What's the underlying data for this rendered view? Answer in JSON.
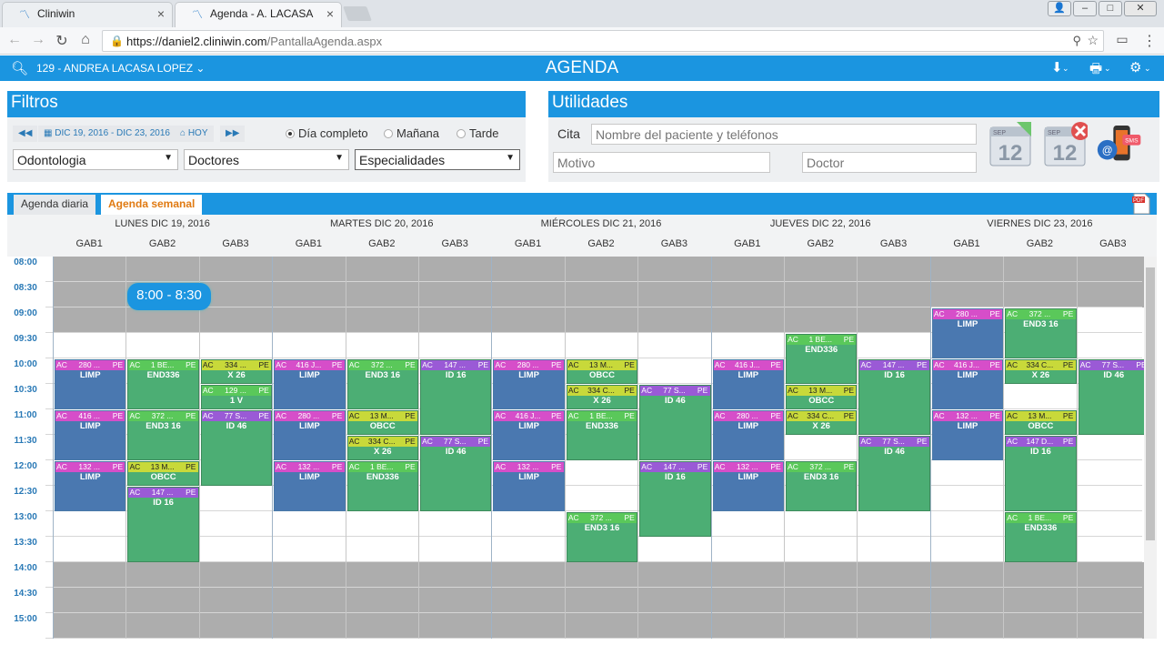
{
  "browser": {
    "tabs": [
      {
        "label": "Cliniwin"
      },
      {
        "label": "Agenda - A. LACASA"
      }
    ],
    "url_host": "https://daniel2.cliniwin.com",
    "url_path": "/PantallaAgenda.aspx"
  },
  "header": {
    "user": "129 - ANDREA LACASA LOPEZ ⌄",
    "title": "AGENDA"
  },
  "filtros": {
    "title": "Filtros",
    "prev": "◀◀",
    "range": "DIC 19, 2016 - DIC 23, 2016",
    "hoy": "HOY",
    "next": "▶▶",
    "radios": [
      {
        "label": "Día completo",
        "checked": true
      },
      {
        "label": "Mañana",
        "checked": false
      },
      {
        "label": "Tarde",
        "checked": false
      }
    ],
    "selects": [
      "Odontologia",
      "Doctores",
      "Especialidades"
    ]
  },
  "utilidades": {
    "title": "Utilidades",
    "cita_label": "Cita",
    "cita_placeholder": "Nombre del paciente y teléfonos",
    "motivo_placeholder": "Motivo",
    "doctor_placeholder": "Doctor",
    "cal_month": "SEP",
    "cal_day": "12",
    "sms_label": "SMS"
  },
  "agenda_tabs": [
    "Agenda diaria",
    "Agenda semanal"
  ],
  "days": [
    "LUNES DIC 19, 2016",
    "MARTES DIC 20, 2016",
    "MIÉRCOLES DIC 21, 2016",
    "JUEVES DIC 22, 2016",
    "VIERNES DIC 23, 2016"
  ],
  "gabs": [
    "GAB1",
    "GAB2",
    "GAB3"
  ],
  "times": [
    "08:00",
    "08:30",
    "09:00",
    "09:30",
    "10:00",
    "10:30",
    "11:00",
    "11:30",
    "12:00",
    "12:30",
    "13:00",
    "13:30",
    "14:00",
    "14:30",
    "15:00",
    "15:30"
  ],
  "tooltip": "8:00 - 8:30",
  "appointments": [
    {
      "d": 0,
      "g": 0,
      "start": 10.0,
      "end": 11.0,
      "hdr": "pink",
      "label": "280 ...",
      "code": "LIMP",
      "color": "blue"
    },
    {
      "d": 0,
      "g": 0,
      "start": 11.0,
      "end": 12.0,
      "hdr": "pink",
      "label": "416 ...",
      "code": "LIMP",
      "color": "blue"
    },
    {
      "d": 0,
      "g": 0,
      "start": 12.0,
      "end": 13.0,
      "hdr": "pink",
      "label": "132 ...",
      "code": "LIMP",
      "color": "blue"
    },
    {
      "d": 0,
      "g": 1,
      "start": 10.0,
      "end": 11.0,
      "hdr": "green",
      "label": "1 BE...",
      "code": "END336",
      "color": "green"
    },
    {
      "d": 0,
      "g": 1,
      "start": 11.0,
      "end": 12.0,
      "hdr": "green",
      "label": "372 ...",
      "code": "END3 16",
      "color": "green"
    },
    {
      "d": 0,
      "g": 1,
      "start": 12.0,
      "end": 12.5,
      "hdr": "yellow",
      "label": "13 M...",
      "code": "OBCC",
      "color": "green"
    },
    {
      "d": 0,
      "g": 1,
      "start": 12.5,
      "end": 14.0,
      "hdr": "purple",
      "label": "147 ...",
      "code": "ID 16",
      "color": "green"
    },
    {
      "d": 0,
      "g": 2,
      "start": 10.0,
      "end": 10.5,
      "hdr": "yellow",
      "label": "334 ...",
      "code": "X 26",
      "color": "green"
    },
    {
      "d": 0,
      "g": 2,
      "start": 10.5,
      "end": 11.0,
      "hdr": "green",
      "label": "129 ...",
      "code": "1 V",
      "color": "green"
    },
    {
      "d": 0,
      "g": 2,
      "start": 11.0,
      "end": 12.5,
      "hdr": "purple",
      "label": "77 S...",
      "code": "ID 46",
      "color": "green"
    },
    {
      "d": 1,
      "g": 0,
      "start": 10.0,
      "end": 11.0,
      "hdr": "pink",
      "label": "416 J...",
      "code": "LIMP",
      "color": "blue"
    },
    {
      "d": 1,
      "g": 0,
      "start": 11.0,
      "end": 12.0,
      "hdr": "pink",
      "label": "280 ...",
      "code": "LIMP",
      "color": "blue"
    },
    {
      "d": 1,
      "g": 0,
      "start": 12.0,
      "end": 13.0,
      "hdr": "pink",
      "label": "132 ...",
      "code": "LIMP",
      "color": "blue"
    },
    {
      "d": 1,
      "g": 1,
      "start": 10.0,
      "end": 11.0,
      "hdr": "green",
      "label": "372 ...",
      "code": "END3 16",
      "color": "green"
    },
    {
      "d": 1,
      "g": 1,
      "start": 11.0,
      "end": 11.5,
      "hdr": "yellow",
      "label": "13 M...",
      "code": "OBCC",
      "color": "green"
    },
    {
      "d": 1,
      "g": 1,
      "start": 11.5,
      "end": 12.0,
      "hdr": "yellow",
      "label": "334 C...",
      "code": "X 26",
      "color": "green"
    },
    {
      "d": 1,
      "g": 1,
      "start": 12.0,
      "end": 13.0,
      "hdr": "green",
      "label": "1 BE...",
      "code": "END336",
      "color": "green"
    },
    {
      "d": 1,
      "g": 2,
      "start": 10.0,
      "end": 11.5,
      "hdr": "purple",
      "label": "147 ...",
      "code": "ID 16",
      "color": "green"
    },
    {
      "d": 1,
      "g": 2,
      "start": 11.5,
      "end": 13.0,
      "hdr": "purple",
      "label": "77 S...",
      "code": "ID 46",
      "color": "green"
    },
    {
      "d": 2,
      "g": 0,
      "start": 10.0,
      "end": 11.0,
      "hdr": "pink",
      "label": "280 ...",
      "code": "LIMP",
      "color": "blue"
    },
    {
      "d": 2,
      "g": 0,
      "start": 11.0,
      "end": 12.0,
      "hdr": "pink",
      "label": "416 J...",
      "code": "LIMP",
      "color": "blue"
    },
    {
      "d": 2,
      "g": 0,
      "start": 12.0,
      "end": 13.0,
      "hdr": "pink",
      "label": "132 ...",
      "code": "LIMP",
      "color": "blue"
    },
    {
      "d": 2,
      "g": 1,
      "start": 10.0,
      "end": 10.5,
      "hdr": "yellow",
      "label": "13 M...",
      "code": "OBCC",
      "color": "green"
    },
    {
      "d": 2,
      "g": 1,
      "start": 10.5,
      "end": 11.0,
      "hdr": "yellow",
      "label": "334 C...",
      "code": "X 26",
      "color": "green"
    },
    {
      "d": 2,
      "g": 1,
      "start": 11.0,
      "end": 12.0,
      "hdr": "green",
      "label": "1 BE...",
      "code": "END336",
      "color": "green"
    },
    {
      "d": 2,
      "g": 1,
      "start": 13.0,
      "end": 14.0,
      "hdr": "green",
      "label": "372 ...",
      "code": "END3 16",
      "color": "green"
    },
    {
      "d": 2,
      "g": 2,
      "start": 10.5,
      "end": 12.0,
      "hdr": "purple",
      "label": "77 S...",
      "code": "ID 46",
      "color": "green"
    },
    {
      "d": 2,
      "g": 2,
      "start": 12.0,
      "end": 13.5,
      "hdr": "purple",
      "label": "147 ...",
      "code": "ID 16",
      "color": "green"
    },
    {
      "d": 3,
      "g": 0,
      "start": 10.0,
      "end": 11.0,
      "hdr": "pink",
      "label": "416 J...",
      "code": "LIMP",
      "color": "blue"
    },
    {
      "d": 3,
      "g": 0,
      "start": 11.0,
      "end": 12.0,
      "hdr": "pink",
      "label": "280 ...",
      "code": "LIMP",
      "color": "blue"
    },
    {
      "d": 3,
      "g": 0,
      "start": 12.0,
      "end": 13.0,
      "hdr": "pink",
      "label": "132 ...",
      "code": "LIMP",
      "color": "blue"
    },
    {
      "d": 3,
      "g": 1,
      "start": 9.5,
      "end": 10.5,
      "hdr": "green",
      "label": "1 BE...",
      "code": "END336",
      "color": "green"
    },
    {
      "d": 3,
      "g": 1,
      "start": 10.5,
      "end": 11.0,
      "hdr": "yellow",
      "label": "13 M...",
      "code": "OBCC",
      "color": "green"
    },
    {
      "d": 3,
      "g": 1,
      "start": 11.0,
      "end": 11.5,
      "hdr": "yellow",
      "label": "334 C...",
      "code": "X 26",
      "color": "green"
    },
    {
      "d": 3,
      "g": 1,
      "start": 12.0,
      "end": 13.0,
      "hdr": "green",
      "label": "372 ...",
      "code": "END3 16",
      "color": "green"
    },
    {
      "d": 3,
      "g": 2,
      "start": 10.0,
      "end": 11.5,
      "hdr": "purple",
      "label": "147 ...",
      "code": "ID 16",
      "color": "green"
    },
    {
      "d": 3,
      "g": 2,
      "start": 11.5,
      "end": 13.0,
      "hdr": "purple",
      "label": "77 S...",
      "code": "ID 46",
      "color": "green"
    },
    {
      "d": 4,
      "g": 0,
      "start": 9.0,
      "end": 10.0,
      "hdr": "pink",
      "label": "280 ...",
      "code": "LIMP",
      "color": "blue"
    },
    {
      "d": 4,
      "g": 0,
      "start": 10.0,
      "end": 11.0,
      "hdr": "pink",
      "label": "416 J...",
      "code": "LIMP",
      "color": "blue"
    },
    {
      "d": 4,
      "g": 0,
      "start": 11.0,
      "end": 12.0,
      "hdr": "pink",
      "label": "132 ...",
      "code": "LIMP",
      "color": "blue"
    },
    {
      "d": 4,
      "g": 1,
      "start": 9.0,
      "end": 10.0,
      "hdr": "green",
      "label": "372 ...",
      "code": "END3 16",
      "color": "green"
    },
    {
      "d": 4,
      "g": 1,
      "start": 10.0,
      "end": 10.5,
      "hdr": "yellow",
      "label": "334 C...",
      "code": "X 26",
      "color": "green"
    },
    {
      "d": 4,
      "g": 1,
      "start": 11.0,
      "end": 11.5,
      "hdr": "yellow",
      "label": "13 M...",
      "code": "OBCC",
      "color": "green"
    },
    {
      "d": 4,
      "g": 1,
      "start": 11.5,
      "end": 13.0,
      "hdr": "purple",
      "label": "147 D...",
      "code": "ID 16",
      "color": "green"
    },
    {
      "d": 4,
      "g": 1,
      "start": 13.0,
      "end": 14.0,
      "hdr": "green",
      "label": "1 BE...",
      "code": "END336",
      "color": "green"
    },
    {
      "d": 4,
      "g": 2,
      "start": 10.0,
      "end": 11.5,
      "hdr": "purple",
      "label": "77 S...",
      "code": "ID 46",
      "color": "green"
    }
  ]
}
